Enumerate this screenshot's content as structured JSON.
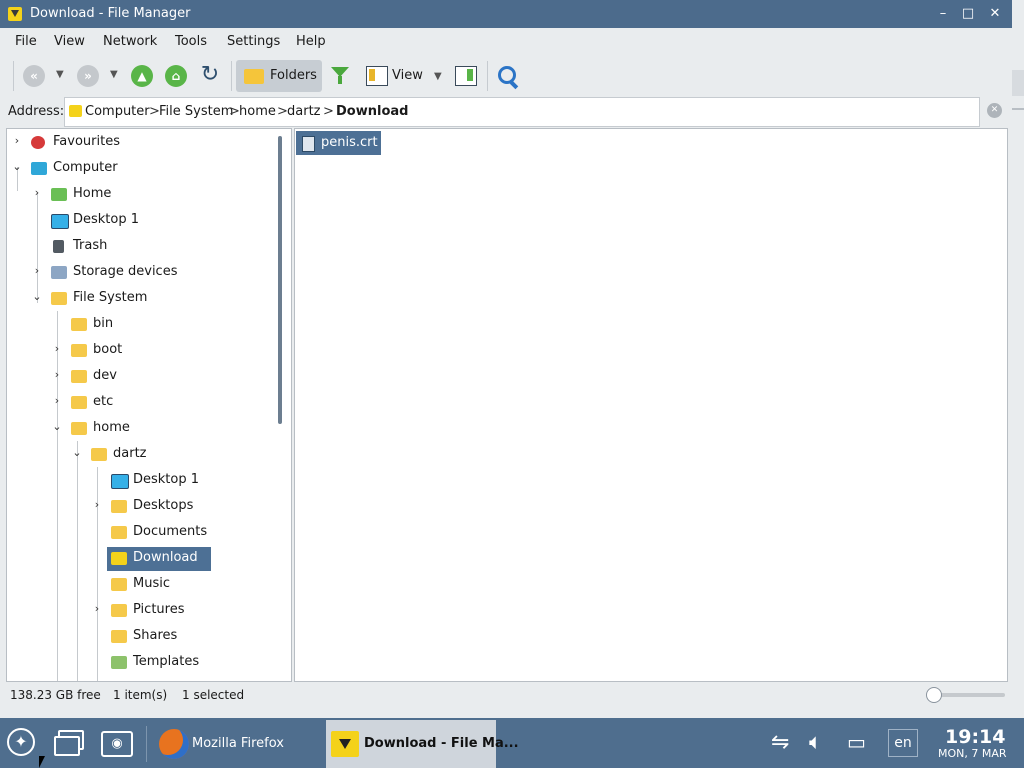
{
  "window": {
    "title": "Download - File Manager",
    "controls": {
      "minimize": "–",
      "maximize": "□",
      "close": "✕"
    }
  },
  "menu": [
    "File",
    "View",
    "Network",
    "Tools",
    "Settings",
    "Help"
  ],
  "toolbar": {
    "folders_label": "Folders",
    "view_label": "View",
    "icons": [
      "back-icon",
      "forward-icon",
      "up-icon",
      "home-icon",
      "refresh-icon",
      "filter-icon",
      "view-icon",
      "preview-icon",
      "search-icon"
    ]
  },
  "address": {
    "label": "Address:",
    "crumbs": [
      "Computer",
      "File System",
      "home",
      "dartz",
      "Download"
    ],
    "separator": ">"
  },
  "tree": {
    "favourites": "Favourites",
    "computer": "Computer",
    "home": "Home",
    "desktop1": "Desktop 1",
    "trash": "Trash",
    "storage": "Storage devices",
    "filesystem": "File System",
    "bin": "bin",
    "boot": "boot",
    "dev": "dev",
    "etc": "etc",
    "home_dir": "home",
    "dartz": "dartz",
    "dartz_desktop1": "Desktop 1",
    "desktops": "Desktops",
    "documents": "Documents",
    "download": "Download",
    "music": "Music",
    "pictures": "Pictures",
    "shares": "Shares",
    "templates": "Templates"
  },
  "files": [
    {
      "name": "penis.crt",
      "selected": true
    }
  ],
  "status": {
    "free": "138.23 GB free",
    "items": "1 item(s)",
    "selected": "1 selected"
  },
  "taskbar": {
    "tasks": [
      {
        "label": "Mozilla Firefox",
        "active": false
      },
      {
        "label": "Download - File Ma...",
        "active": true
      }
    ],
    "language": "en",
    "time": "19:14",
    "date": "MON, 7 MAR"
  },
  "colors": {
    "titlebar": "#4c6b8c",
    "selection": "#4d7095",
    "taskbar": "#4f6e8e",
    "folder": "#f5c94a"
  }
}
